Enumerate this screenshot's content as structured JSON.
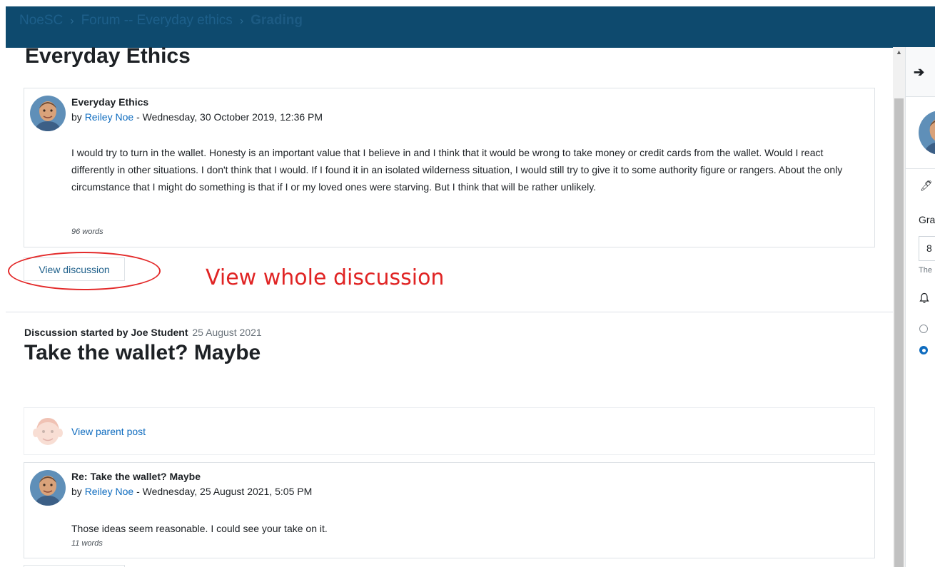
{
  "breadcrumb": {
    "items": [
      "NoeSC",
      "Forum -- Everyday ethics"
    ],
    "current": "Grading",
    "separator": "›"
  },
  "forum": {
    "title": "Everyday Ethics"
  },
  "post1": {
    "subject": "Everyday Ethics",
    "by_prefix": "by",
    "author": "Reiley Noe",
    "date": "- Wednesday, 30 October 2019, 12:36 PM",
    "body": "I would try to turn in the wallet. Honesty is an important value that I believe in and I think that it would be wrong to take money or credit cards from the wallet. Would I react differently in other situations. I don't think that I would. If I found it in an isolated wilderness situation, I would still try to give it to some authority figure or rangers. About the only circumstance that I might do something is that if I or my loved ones were starving. But I think that will be rather unlikely.",
    "word_count": "96 words"
  },
  "view_discussion_label": "View discussion",
  "annotation": {
    "text": "View whole discussion",
    "color": "#e02424"
  },
  "discussion": {
    "started_by": "Discussion started by Joe Student",
    "date": "25 August 2021",
    "title": "Take the wallet? Maybe",
    "view_parent_label": "View parent post"
  },
  "post2": {
    "subject": "Re: Take the wallet? Maybe",
    "by_prefix": "by",
    "author": "Reiley Noe",
    "date": "- Wednesday, 25 August 2021, 5:05 PM",
    "body": "Those ideas seem reasonable. I could see your take on it.",
    "word_count": "11 words"
  },
  "drawer": {
    "close_icon": "arrow-right-icon",
    "grade_label_partial": "Gra",
    "grade_value_partial": "8",
    "help_partial": "The"
  },
  "colors": {
    "header": "#0e4a6e",
    "link": "#0f6cbf",
    "annotation": "#e02424"
  }
}
